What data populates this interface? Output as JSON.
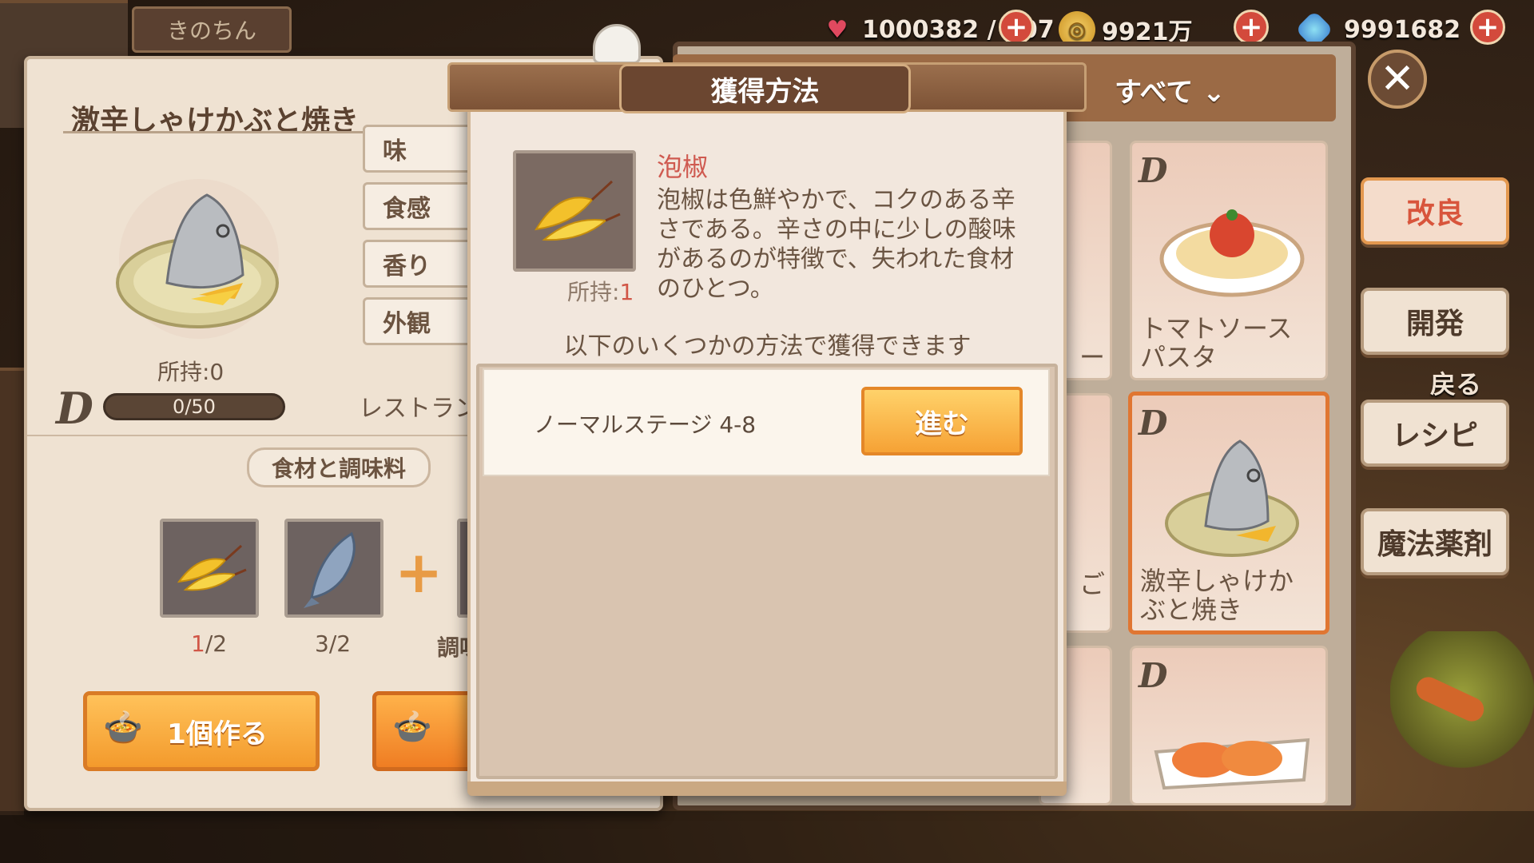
{
  "player": {
    "name": "きのちん"
  },
  "resources": {
    "stamina": "1000382 / 107",
    "gold": "9921万",
    "gems": "9991682"
  },
  "left_panel": {
    "recipe_name": "激辛しゃけかぶと焼き",
    "attributes": [
      "味",
      "食感",
      "香り",
      "外観"
    ],
    "restaurant_label": "レストラン",
    "owned_label": "所持:0",
    "progress_text": "0/50",
    "progress_value": 0,
    "ingredients_label": "食材と調味料",
    "ingredients": [
      {
        "icon": "pepper-icon",
        "have": "1",
        "need": "/2",
        "have_color": "#d15647"
      },
      {
        "icon": "fish-icon",
        "have": "3",
        "need": "/2",
        "have_color": "#6a5544"
      }
    ],
    "seasoning_label": "調味",
    "make_one_label": "1個作る"
  },
  "list_panel": {
    "filter_label": "すべて",
    "cards": [
      {
        "label": "トマトソースパスタ",
        "icon": "tomato-pasta-icon"
      },
      {
        "label": "激辛しゃけかぶと焼き",
        "icon": "salmon-head-icon",
        "selected": true
      },
      {
        "label": "",
        "icon": "salmon-sashimi-icon"
      }
    ],
    "partial_texts": [
      "ー",
      "ご"
    ]
  },
  "side_menu": {
    "improve": "改良",
    "develop": "開発",
    "back": "戻る",
    "recipe": "レシピ",
    "magic_potion": "魔法薬剤"
  },
  "modal": {
    "title": "獲得方法",
    "item_name": "泡椒",
    "item_desc": "泡椒は色鮮やかで、コクのある辛さである。辛さの中に少しの酸味があるのが特徴で、失われた食材のひとつ。",
    "owned_prefix": "所持:",
    "owned_count": "1",
    "ways_label": "以下のいくつかの方法で獲得できます",
    "sources": [
      {
        "label": "ノーマルステージ 4-8",
        "button": "進む"
      }
    ]
  },
  "colors": {
    "accent_orange": "#f39a2c",
    "danger_red": "#d15647",
    "panel_brown": "#7d5336"
  }
}
